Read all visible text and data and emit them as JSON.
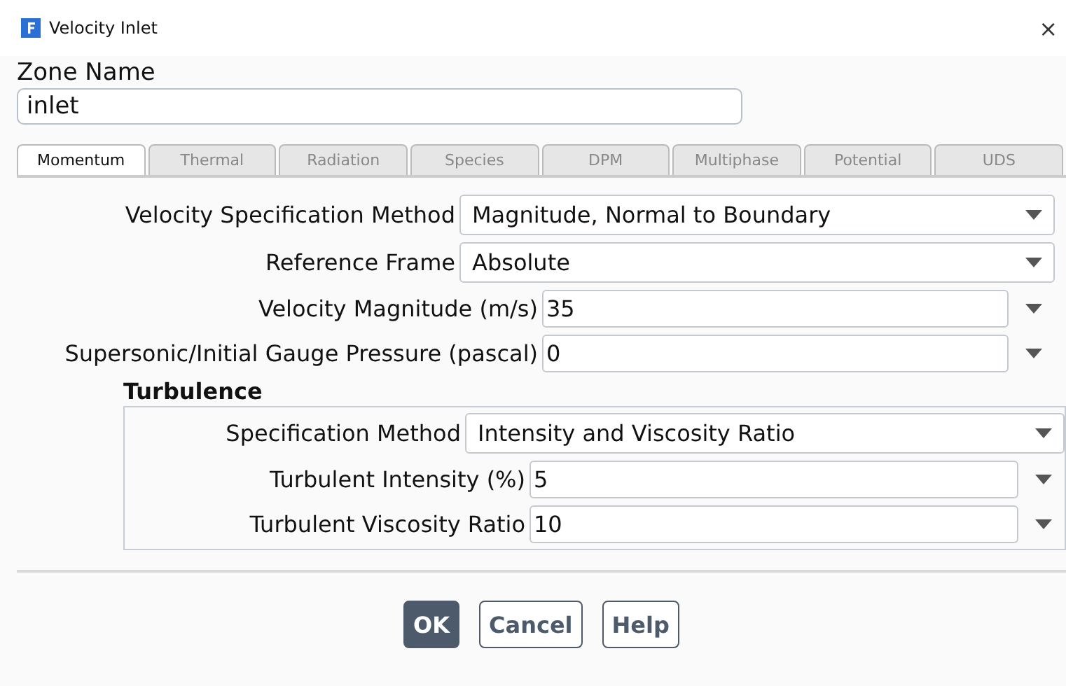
{
  "window": {
    "title": "Velocity Inlet",
    "close": "×"
  },
  "zone_name": {
    "label": "Zone Name",
    "value": "inlet"
  },
  "tabs": [
    {
      "label": "Momentum",
      "selected": true
    },
    {
      "label": "Thermal",
      "selected": false
    },
    {
      "label": "Radiation",
      "selected": false
    },
    {
      "label": "Species",
      "selected": false
    },
    {
      "label": "DPM",
      "selected": false
    },
    {
      "label": "Multiphase",
      "selected": false
    },
    {
      "label": "Potential",
      "selected": false
    },
    {
      "label": "UDS",
      "selected": false
    }
  ],
  "fields": [
    {
      "kind": "dropdown",
      "label": "Velocity Specification Method",
      "value": "Magnitude, Normal to Boundary"
    },
    {
      "kind": "dropdown",
      "label": "Reference Frame",
      "value": "Absolute"
    },
    {
      "kind": "number",
      "label": "Velocity Magnitude (m/s)",
      "value": "35"
    },
    {
      "kind": "number",
      "label": "Supersonic/Initial Gauge Pressure (pascal)",
      "value": "0"
    }
  ],
  "turbulence": {
    "title": "Turbulence",
    "fields": [
      {
        "kind": "dropdown",
        "label": "Specification Method",
        "value": "Intensity and Viscosity Ratio"
      },
      {
        "kind": "number",
        "label": "Turbulent Intensity (%)",
        "value": "5"
      },
      {
        "kind": "number",
        "label": "Turbulent Viscosity Ratio",
        "value": "10"
      }
    ]
  },
  "buttons": [
    {
      "label": "OK",
      "kind": "primary"
    },
    {
      "label": "Cancel",
      "kind": "secondary"
    },
    {
      "label": "Help",
      "kind": "secondary"
    }
  ]
}
